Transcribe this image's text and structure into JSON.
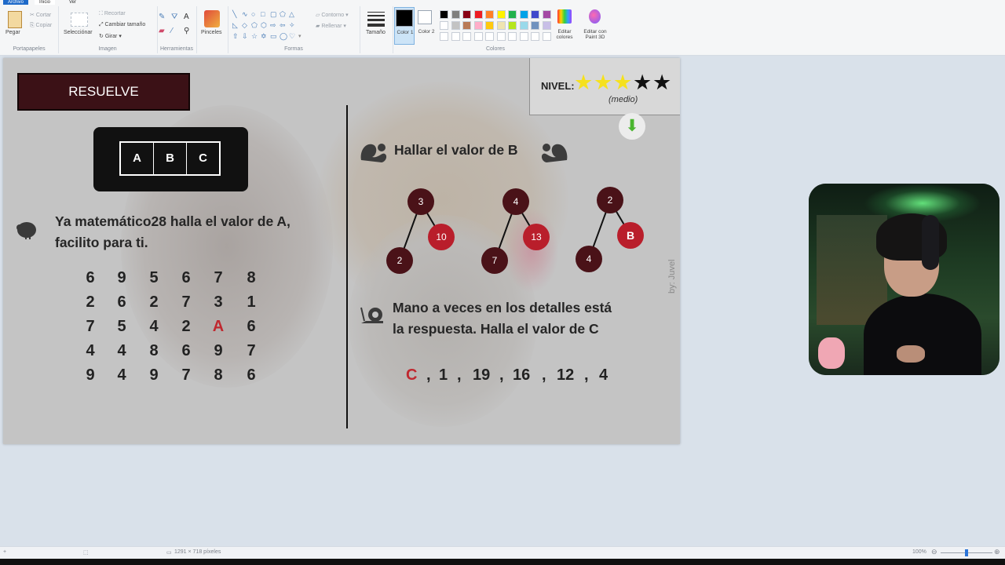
{
  "ribbon": {
    "menu": {
      "file": "Archivo",
      "home": "Inicio",
      "view": "Ver"
    },
    "clipboard": {
      "paste": "Pegar",
      "cut": "Cortar",
      "copy": "Copiar",
      "group": "Portapapeles"
    },
    "image": {
      "select": "Selecciónar",
      "crop": "Recortar",
      "resize": "Cambiar tamaño",
      "rotate": "Girar",
      "group": "Imagen"
    },
    "tools": {
      "group": "Herramientas"
    },
    "brushes": {
      "label": "Pinceles"
    },
    "shapes": {
      "outline": "Contorno",
      "fill": "Rellenar",
      "group": "Formas"
    },
    "size": {
      "label": "Tamaño"
    },
    "color1": {
      "label": "Color 1",
      "value": "#000000"
    },
    "color2": {
      "label": "Color 2",
      "value": "#ffffff"
    },
    "colors": {
      "group": "Colores",
      "row1": [
        "#000000",
        "#7f7f7f",
        "#880015",
        "#ed1c24",
        "#ff7f27",
        "#fff200",
        "#22b14c",
        "#00a2e8",
        "#3f48cc",
        "#a349a4"
      ],
      "row2": [
        "#ffffff",
        "#c3c3c3",
        "#b97a57",
        "#ffaec9",
        "#ffc90e",
        "#efe4b0",
        "#b5e61d",
        "#99d9ea",
        "#7092be",
        "#c8bfe7"
      ]
    },
    "edit_colors": "Editar colores",
    "edit_paint3d": "Editar con Paint 3D"
  },
  "puzzle": {
    "resuelve": "RESUELVE",
    "abc": [
      "A",
      "B",
      "C"
    ],
    "question_a_line1": "Ya matemático28 halla el valor de A,",
    "question_a_line2": "facilito para ti.",
    "grid": [
      [
        "6",
        "9",
        "5",
        "6",
        "7",
        "8"
      ],
      [
        "2",
        "6",
        "2",
        "7",
        "3",
        "1"
      ],
      [
        "7",
        "5",
        "4",
        "2",
        "A",
        "6"
      ],
      [
        "4",
        "4",
        "8",
        "6",
        "9",
        "7"
      ],
      [
        "9",
        "4",
        "9",
        "7",
        "8",
        "6"
      ]
    ],
    "nivel_label": "NIVEL:",
    "nivel_stars_filled": 3,
    "nivel_stars_total": 5,
    "nivel_medio": "(medio)",
    "question_b": "Hallar el valor de B",
    "trees": [
      {
        "top": "3",
        "left": "2",
        "right": "10"
      },
      {
        "top": "4",
        "left": "7",
        "right": "13"
      },
      {
        "top": "2",
        "left": "4",
        "right": "B"
      }
    ],
    "question_c_line1": "Mano a veces en los detalles está",
    "question_c_line2": "la respuesta. Halla el valor de C",
    "sequence": [
      "C",
      "1",
      "19",
      "16",
      "12",
      "4"
    ],
    "sequence_sep": ",",
    "credit": "by: Juvel"
  },
  "status": {
    "dimensions": "1291 × 718 píxeles",
    "zoom": "100%"
  }
}
